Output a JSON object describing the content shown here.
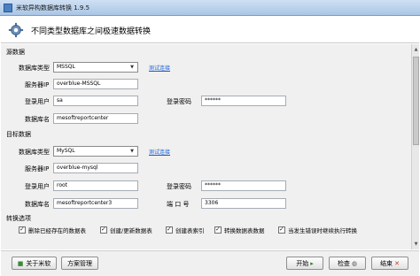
{
  "window": {
    "title": "米软异构数据库转换 1.9.5",
    "icon": "app-icon"
  },
  "header": {
    "title": "不同类型数据库之间极速数据转换",
    "icon": "gear-icon"
  },
  "source": {
    "group_label": "源数据",
    "db_type_label": "数据库类型",
    "db_type_value": "MSSQL",
    "test_link": "测试连接",
    "server_label": "服务器IP",
    "server_value": "overblue-MSSQL",
    "user_label": "登录用户",
    "user_value": "sa",
    "password_label": "登录密码",
    "password_value": "******",
    "dbname_label": "数据库名",
    "dbname_value": "mesoftreportcenter"
  },
  "target": {
    "group_label": "目标数据",
    "db_type_label": "数据库类型",
    "db_type_value": "MySQL",
    "test_link": "测试连接",
    "server_label": "服务器IP",
    "server_value": "overblue-mysql",
    "user_label": "登录用户",
    "user_value": "root",
    "password_label": "登录密码",
    "password_value": "******",
    "dbname_label": "数据库名",
    "dbname_value": "mesoftreportcenter3",
    "port_label": "端 口 号",
    "port_value": "3306"
  },
  "options": {
    "group_label": "转换选项",
    "items": [
      {
        "label": "删除已经存在的数据表",
        "checked": true
      },
      {
        "label": "创建/更新数据表",
        "checked": true
      },
      {
        "label": "创建表索引",
        "checked": true
      },
      {
        "label": "转换数据表数据",
        "checked": true
      },
      {
        "label": "当发生错误时继续执行转换",
        "checked": true
      }
    ]
  },
  "footer": {
    "about_label": "关于米软",
    "scheme_label": "方案管理",
    "start_label": "开始",
    "check_label": "检查",
    "exit_label": "结束"
  },
  "colors": {
    "link": "#1a5fd1",
    "titlebar": "#a9c6e6",
    "panel": "#f0f0f0"
  }
}
